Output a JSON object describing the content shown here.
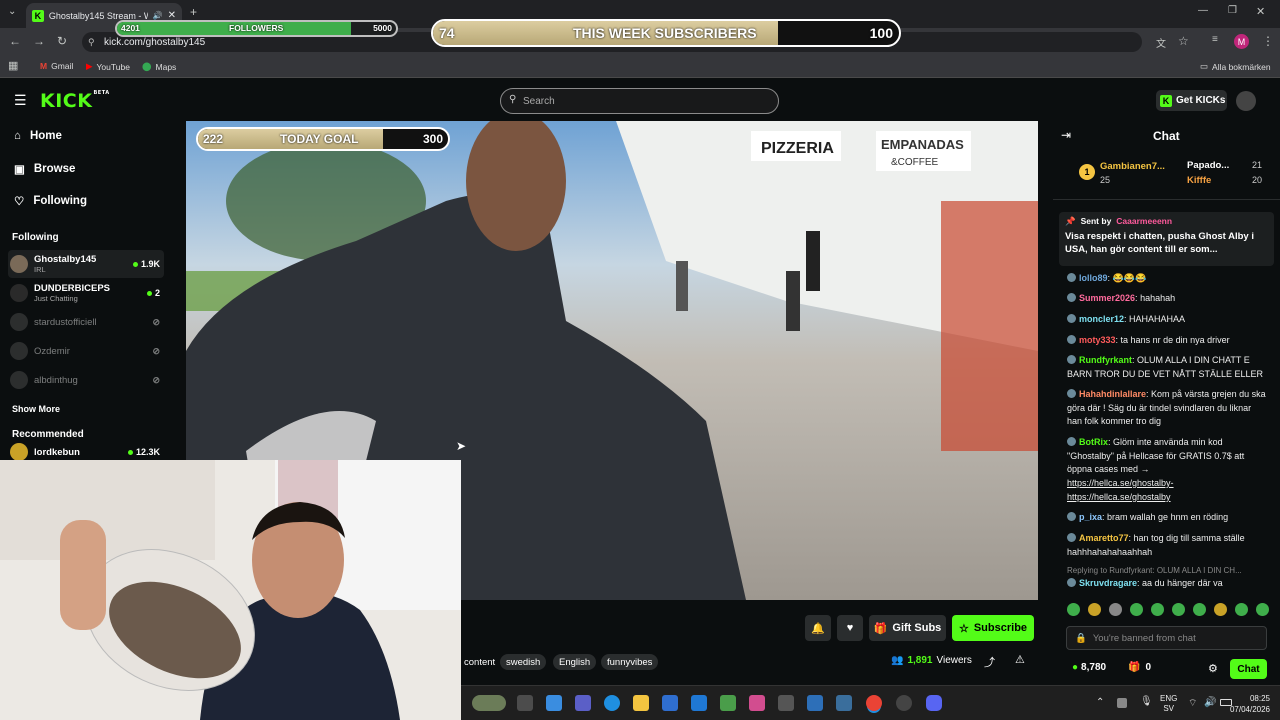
{
  "browser": {
    "tab_title": "Ghostalby145 Stream - Wat",
    "url": "kick.com/ghostalby145",
    "bookmarks": [
      "Gmail",
      "YouTube",
      "Maps"
    ],
    "all_bookmarks": "Alla bokmärken",
    "profile_initial": "M"
  },
  "overlay": {
    "followers_label": "FOLLOWERS",
    "followers_current": "4201",
    "followers_goal": "5000",
    "followers_progress": 0.84,
    "subs_label": "THIS WEEK SUBSCRIBERS",
    "subs_current": "74",
    "subs_goal": "100",
    "subs_progress": 0.74,
    "today_label": "TODAY GOAL",
    "today_current": "222",
    "today_goal": "300",
    "today_progress": 0.74
  },
  "header": {
    "logo": "KICK",
    "beta": "BETA",
    "search_placeholder": "Search",
    "get_kicks": "Get KICKs"
  },
  "sidebar": {
    "nav": [
      "Home",
      "Browse",
      "Following"
    ],
    "following_title": "Following",
    "channels": [
      {
        "name": "Ghostalby145",
        "sub": "IRL",
        "count": "1.9K",
        "live": true
      },
      {
        "name": "DUNDERBICEPS",
        "sub": "Just Chatting",
        "count": "2",
        "live": true
      },
      {
        "name": "stardustofficiell",
        "sub": "",
        "count": "",
        "live": false
      },
      {
        "name": "Ozdemir",
        "sub": "",
        "count": "",
        "live": false
      },
      {
        "name": "albdinthug",
        "sub": "",
        "count": "",
        "live": false
      }
    ],
    "show_more": "Show More",
    "recommended_title": "Recommended",
    "recommended": [
      {
        "name": "lordkebun",
        "count": "12.3K"
      }
    ]
  },
  "stream": {
    "buttons": {
      "gift": "Gift Subs",
      "subscribe": "Subscribe"
    },
    "tags": [
      "content",
      "swedish",
      "English",
      "funnyvibes"
    ],
    "viewers": "1,891",
    "viewers_label": "Viewers"
  },
  "chat": {
    "title": "Chat",
    "leaderboard": [
      {
        "rank": "1",
        "name": "Gambianen7...",
        "value": "25"
      },
      {
        "name": "Papado...",
        "value": "21"
      },
      {
        "name": "Kifffe",
        "value": "20"
      }
    ],
    "pinned": {
      "sent_by": "Sent by",
      "author": "Caaarmeeenn",
      "text": "Visa respekt i chatten, pusha Ghost Alby i USA, han gör content till er som..."
    },
    "messages": [
      {
        "user": "lollo89",
        "color": "#6fa8dc",
        "text": "😂😂😂"
      },
      {
        "user": "Summer2026",
        "color": "#ff6b9d",
        "text": "hahahah"
      },
      {
        "user": "moncler12",
        "color": "#7ee0f0",
        "text": "HAHAHAHAA"
      },
      {
        "user": "moty333",
        "color": "#ff5b5b",
        "text": "ta hans nr de din nya driver"
      },
      {
        "user": "Rundfyrkant",
        "color": "#53fc18",
        "text": "OLUM ALLA I DIN CHATT E BARN TROR DU DE VET NÅTT STÄLLE ELLER"
      },
      {
        "user": "Hahahdinlallare",
        "color": "#ff8a65",
        "text": "Kom på värsta grejen du ska göra där ! Säg du är tindel svindlaren du liknar han folk kommer tro dig"
      },
      {
        "user": "BotRix",
        "color": "#53fc18",
        "text": "Glöm inte använda min kod \"Ghostalby\" på Hellcase för GRATIS 0.7$ att öppna cases med →"
      },
      {
        "user": "p_ixa",
        "color": "#8ec9ff",
        "text": "bram wallah ge hnm en röding"
      },
      {
        "user": "Amaretto77",
        "color": "#f5c542",
        "text": "han tog dig till samma ställe hahhhahahahaahhah"
      },
      {
        "user": "Skruvdragare",
        "color": "#7ee0f0",
        "text": "aa du hänger där va"
      }
    ],
    "links": [
      "https://hellca.se/ghostalby-",
      "https://hellca.se/ghostalby"
    ],
    "replying_to": "Replying to Rundfyrkant: OLUM ALLA I DIN CH...",
    "banned_placeholder": "You're banned from chat",
    "points": "8,780",
    "zero": "0",
    "chat_button": "Chat"
  },
  "taskbar": {
    "lang": "ENG",
    "region": "SV",
    "time": "08:25",
    "date": "07/04/2026"
  },
  "colors": {
    "kick_green": "#53fc18",
    "bg": "#0b0e0f"
  }
}
